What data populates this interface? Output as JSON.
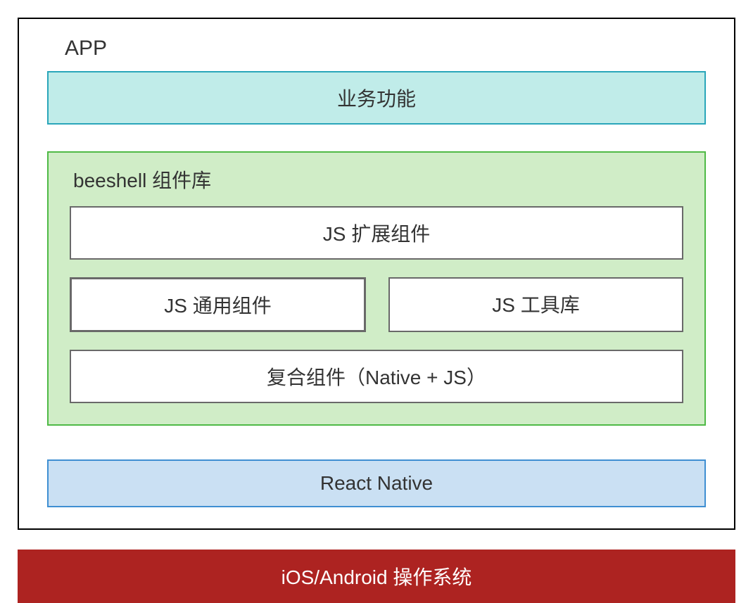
{
  "app": {
    "label": "APP",
    "business": "业务功能",
    "beeshell": {
      "label": "beeshell 组件库",
      "js_extend": "JS 扩展组件",
      "js_common": "JS 通用组件",
      "js_tools": "JS 工具库",
      "compound": "复合组件（Native + JS）"
    },
    "react_native": "React Native"
  },
  "os": "iOS/Android 操作系统",
  "colors": {
    "business_border": "#2aa6ba",
    "business_bg": "#c0ece9",
    "beeshell_border": "#4fba46",
    "beeshell_bg": "#d0edc7",
    "react_native_border": "#3f8fd2",
    "react_native_bg": "#cae0f3",
    "os_bg": "#ad2321",
    "box_border": "#696969"
  }
}
